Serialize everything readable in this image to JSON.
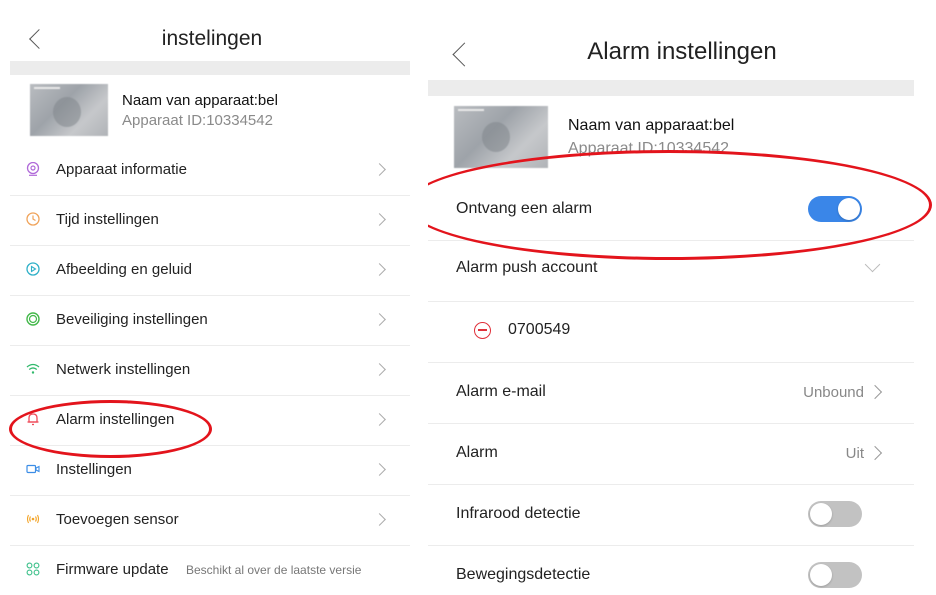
{
  "left": {
    "title": "instelingen",
    "device": {
      "name": "Naam van apparaat:bel",
      "id": "Apparaat ID:10334542"
    },
    "menu": [
      {
        "label": "Apparaat informatie",
        "icon": "camera-icon",
        "color": "#b06ad9"
      },
      {
        "label": "Tijd instellingen",
        "icon": "clock-icon",
        "color": "#f0a35a"
      },
      {
        "label": "Afbeelding en geluid",
        "icon": "play-icon",
        "color": "#2fb0c8"
      },
      {
        "label": "Beveiliging instellingen",
        "icon": "shield-ring-icon",
        "color": "#43b84a"
      },
      {
        "label": "Netwerk instellingen",
        "icon": "wifi-icon",
        "color": "#31b96c"
      },
      {
        "label": "Alarm instellingen",
        "icon": "bell-icon",
        "color": "#ef4c5a"
      },
      {
        "label": "Instellingen",
        "icon": "video-icon",
        "color": "#3b8de6"
      },
      {
        "label": "Toevoegen sensor",
        "icon": "sensor-icon",
        "color": "#f3a428"
      },
      {
        "label": "Firmware update",
        "sub": "Beschikt al over de laatste versie",
        "icon": "grid-icon",
        "color": "#3cc08a"
      }
    ]
  },
  "right": {
    "title": "Alarm instellingen",
    "device": {
      "name": "Naam van apparaat:bel",
      "id": "Apparaat ID:10334542"
    },
    "rows": {
      "receive_alarm": {
        "label": "Ontvang een alarm",
        "toggle": "on"
      },
      "push_account": {
        "label": "Alarm push account"
      },
      "account_number": "0700549",
      "email": {
        "label": "Alarm e-mail",
        "value": "Unbound"
      },
      "alarm": {
        "label": "Alarm",
        "value": "Uit"
      },
      "infrared": {
        "label": "Infrarood detectie",
        "toggle": "off"
      },
      "motion": {
        "label": "Bewegingsdetectie",
        "toggle": "off"
      }
    }
  },
  "colors": {
    "toggle_on": "#3a86e8",
    "toggle_off": "#c2c2c2",
    "annotation": "#e3141c",
    "remove": "#e0303a"
  }
}
